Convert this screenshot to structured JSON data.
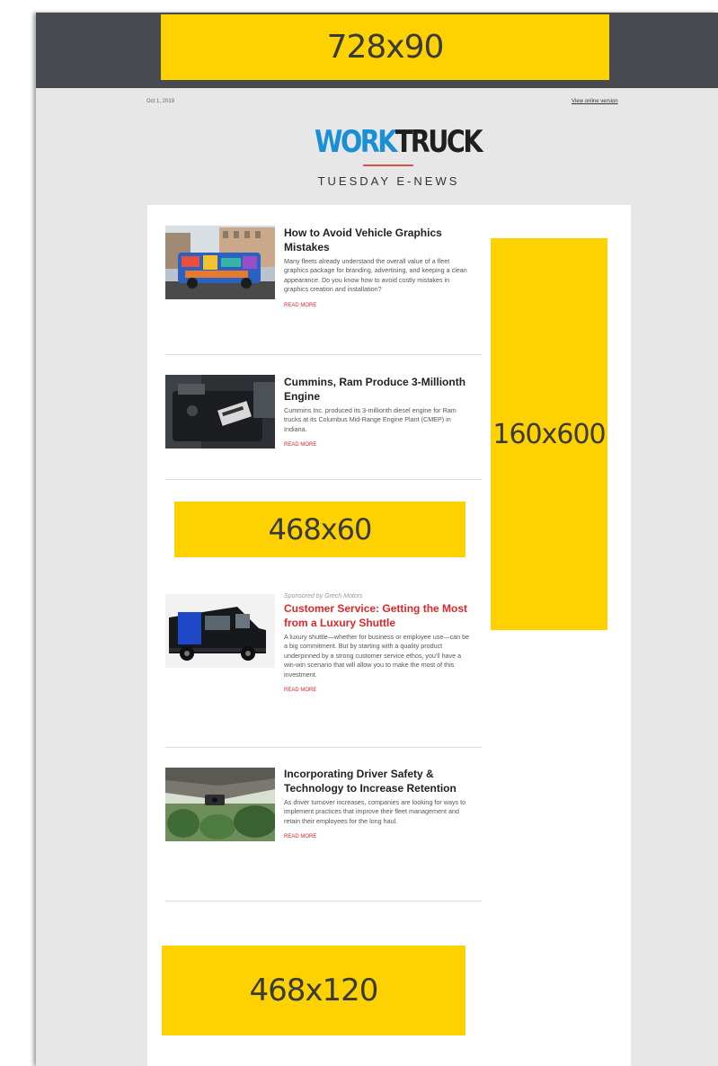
{
  "header": {
    "banner_ad": "728x90",
    "date": "Oct 1, 2019",
    "online_link": "View online version",
    "logo_part1": "WORK",
    "logo_part2": "TRUCK",
    "subtitle": "TUESDAY E-NEWS"
  },
  "ads": {
    "side": "160x600",
    "mid": "468x60",
    "bottom": "468x120"
  },
  "articles": [
    {
      "title": "How to Avoid Vehicle Graphics Mistakes",
      "summary": "Many fleets already understand the overall value of a fleet graphics package for branding, advertising, and keeping a clean appearance. Do you know how to avoid costly mistakes in graphics creation and installation?",
      "read_more": "READ MORE"
    },
    {
      "title": "Cummins, Ram Produce 3-Millionth Engine",
      "summary": "Cummins Inc. produced its 3-millionth diesel engine for Ram trucks at its Columbus Mid-Range Engine Plant (CMEP) in Indiana.",
      "read_more": "READ MORE"
    },
    {
      "sponsor": "Sponsored by Grech Motors",
      "title": "Customer Service: Getting the Most from a Luxury Shuttle",
      "summary": "A luxury shuttle—whether for business or employee use—can be a big commitment. But by starting with a quality product underpinned by a strong customer service ethos, you'll have a win-win scenario that will allow you to make the most of this investment.",
      "read_more": "READ MORE"
    },
    {
      "title": "Incorporating Driver Safety & Technology to Increase Retention",
      "summary": "As driver turnover increases, companies are looking for ways to implement practices that improve their fleet management and retain their employees for the long haul.",
      "read_more": "READ MORE"
    }
  ],
  "colors": {
    "ad_yellow": "#fdd200",
    "header_gray": "#474a50",
    "logo_blue": "#1a8fd6",
    "accent_red": "#e0262b"
  }
}
